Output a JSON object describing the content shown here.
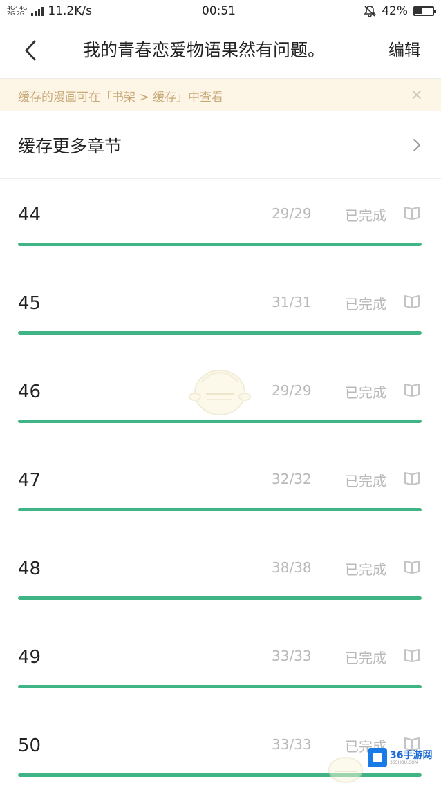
{
  "status_bar": {
    "network_top": "4G⁺ 4G",
    "network_bottom": "2G 2G",
    "speed": "11.2K/s",
    "time": "00:51",
    "battery": "42%",
    "battery_level": 0.42
  },
  "header": {
    "title": "我的青春恋爱物语果然有问题。",
    "edit_label": "编辑",
    "back_icon": "chevron-left-icon"
  },
  "notice": {
    "text": "缓存的漫画可在「书架 > 缓存」中查看",
    "close": "×"
  },
  "more_chapters": {
    "label": "缓存更多章节"
  },
  "chapters": [
    {
      "number": "44",
      "count": "29/29",
      "status": "已完成",
      "progress": 1.0
    },
    {
      "number": "45",
      "count": "31/31",
      "status": "已完成",
      "progress": 1.0
    },
    {
      "number": "46",
      "count": "29/29",
      "status": "已完成",
      "progress": 1.0
    },
    {
      "number": "47",
      "count": "32/32",
      "status": "已完成",
      "progress": 1.0
    },
    {
      "number": "48",
      "count": "38/38",
      "status": "已完成",
      "progress": 1.0
    },
    {
      "number": "49",
      "count": "33/33",
      "status": "已完成",
      "progress": 1.0
    },
    {
      "number": "50",
      "count": "33/33",
      "status": "已完成",
      "progress": 1.0
    }
  ],
  "watermark": {
    "text": "36手游网",
    "sub": "36SHOU.COM"
  },
  "colors": {
    "accent": "#3fb485",
    "notice_bg": "#fdf6e6",
    "notice_text": "#c8a979",
    "muted": "#b9b9b9"
  }
}
